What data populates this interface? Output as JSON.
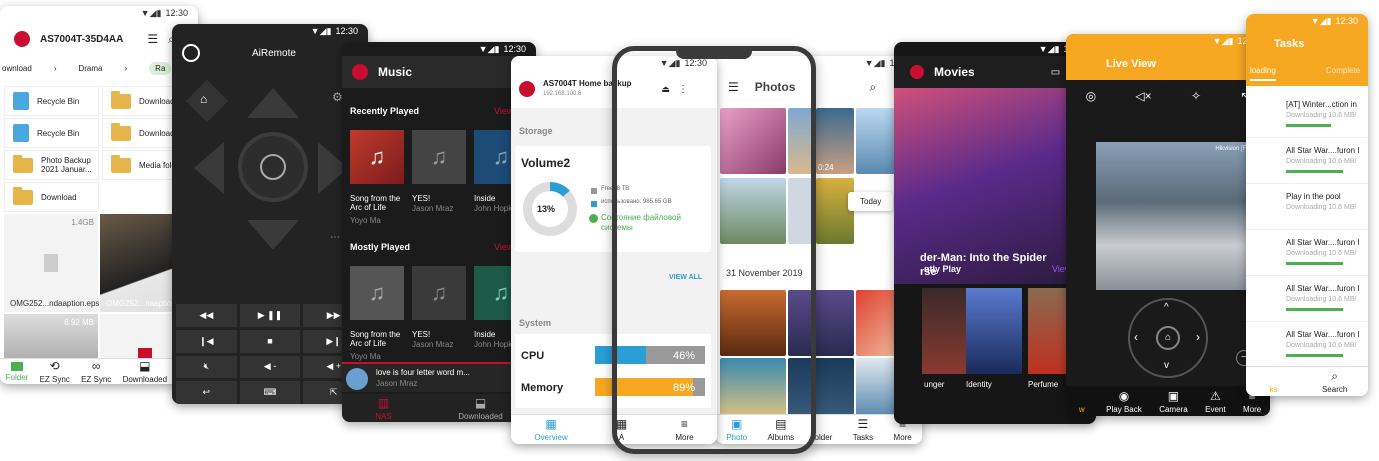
{
  "status": {
    "time": "12:30"
  },
  "files": {
    "title": "AS7004T-35D4AA",
    "tabs": [
      "ownload",
      "Drama",
      "Ra"
    ],
    "items": [
      "Recycle Bin",
      "Download",
      "Recycle Bin",
      "Download",
      "Photo Backup 2021 Januar...",
      "Media fold",
      "Download"
    ],
    "size1": "1.4GB",
    "file1": "OMG252...ndaaption.eps",
    "file2": "OMG252...naaption",
    "size2": "6.92 MB",
    "nav": [
      "Folder",
      "EZ Sync",
      "EZ Sync",
      "Downloaded",
      "T"
    ]
  },
  "remote": {
    "title": "AiRemote"
  },
  "music": {
    "title": "Music",
    "recent_label": "Recently Played",
    "view_label": "View",
    "recent": [
      {
        "title": "Song from the Arc of Life",
        "artist": "Yoyo Ma"
      },
      {
        "title": "YES!",
        "artist": "Jason Mraz"
      },
      {
        "title": "Inside",
        "artist": "John Hopki"
      }
    ],
    "mostly_label": "Mostly Played",
    "mostly": [
      {
        "title": "Song from the Arc of Life",
        "artist": "Yoyo Ma"
      },
      {
        "title": "YES!",
        "artist": "Jason Mraz"
      },
      {
        "title": "Inside",
        "artist": "John Hopki"
      }
    ],
    "now_title": "love is four letter word m...",
    "now_artist": "Jason Mraz",
    "nav": [
      "NAS",
      "Downloaded"
    ]
  },
  "storage": {
    "device": "AS7004T Home backup",
    "ip": "192.168.100.6",
    "section": "Storage",
    "volume": "Volume2",
    "percent": "13%",
    "free": "Free: 8 TB",
    "used": "использовано: 985.65 GB",
    "status": "Состояние файловой системы",
    "view_all": "VIEW ALL",
    "system": "System",
    "cpu_label": "CPU",
    "cpu": "46%",
    "cpu_value": 46,
    "mem_label": "Memory",
    "mem": "89%",
    "mem_value": 89,
    "nav": [
      "Overview",
      "A",
      "More"
    ]
  },
  "photos": {
    "title": "Photos",
    "today": "Today",
    "date": "31 November 2019",
    "time": "0:24",
    "nav": [
      "Photo",
      "Albums",
      "older",
      "Tasks",
      "More"
    ]
  },
  "movies": {
    "title": "Movies",
    "hero": "der-Man: Into the Spider",
    "hero2": "rse",
    "recent_label": "ntly Play",
    "view_all": "View All",
    "titles": [
      "unger",
      "Identity",
      "Perfume"
    ]
  },
  "live": {
    "title": "Live View",
    "cam_label": "Hikvision [FPS 3.0]",
    "nav": [
      "w",
      "Play Back",
      "Camera",
      "Event",
      "More"
    ]
  },
  "tasks": {
    "title": "Tasks",
    "tabs": [
      "loading",
      "Complete"
    ],
    "items": [
      {
        "name": "[AT] Winter...ction in",
        "sub": "Downloading 10.6 MB/",
        "progress": 0.55
      },
      {
        "name": "All Star War....furon I",
        "sub": "Downloading 10.6 MB/",
        "progress": 0.7
      },
      {
        "name": "Play in the pool",
        "sub": "Downloading 10.6 MB/",
        "progress": 0.0
      },
      {
        "name": "All Star War....furon I",
        "sub": "Downloading 10.6 MB/",
        "progress": 0.7
      },
      {
        "name": "All Star War....furon I",
        "sub": "Downloading 10.6 MB/",
        "progress": 0.7
      },
      {
        "name": "All Star War....furon I",
        "sub": "Downloading 10.6 MB/",
        "progress": 0.7
      }
    ],
    "nav": [
      "ks",
      "Search"
    ]
  },
  "colors": {
    "accent_red": "#c8102e",
    "accent_blue": "#2a9fd6",
    "accent_orange": "#f7a823",
    "accent_green": "#4caf50",
    "movie_purple": "#9b59ff"
  }
}
